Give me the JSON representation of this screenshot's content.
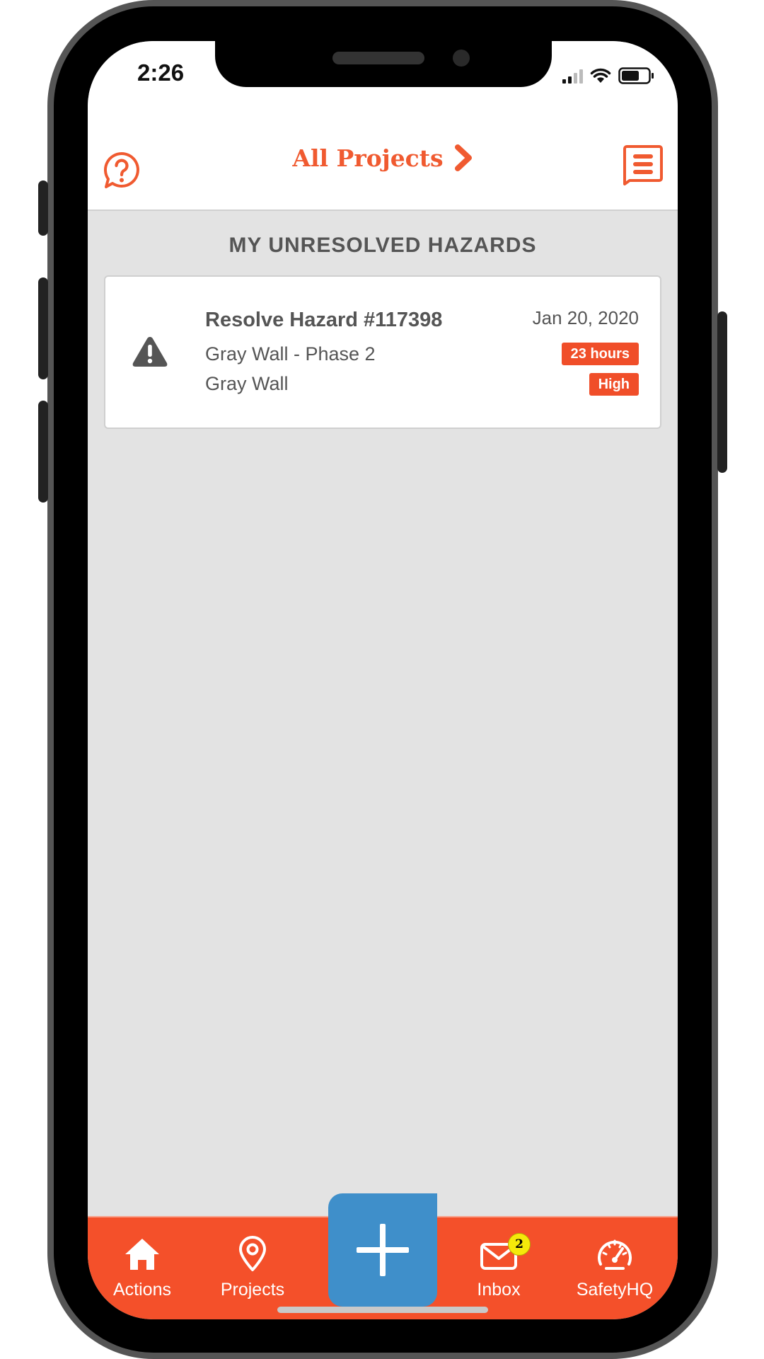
{
  "status_bar": {
    "time": "2:26"
  },
  "header": {
    "title": "All Projects"
  },
  "section": {
    "title": "MY UNRESOLVED HAZARDS"
  },
  "hazards": [
    {
      "title": "Resolve Hazard #117398",
      "project": "Gray Wall - Phase 2",
      "location": "Gray Wall",
      "date": "Jan 20, 2020",
      "age_badge": "23 hours",
      "severity_badge": "High"
    }
  ],
  "tabs": [
    {
      "label": "Actions",
      "icon": "home-icon"
    },
    {
      "label": "Projects",
      "icon": "map-pin-icon"
    },
    {
      "label": "Inbox",
      "icon": "envelope-icon",
      "badge_count": "2"
    },
    {
      "label": "SafetyHQ",
      "icon": "speedometer-icon"
    }
  ],
  "colors": {
    "brand_orange": "#f4502a",
    "add_button_blue": "#3f8fca",
    "badge_yellow": "#f5e90a",
    "background_gray": "#e3e3e3"
  }
}
